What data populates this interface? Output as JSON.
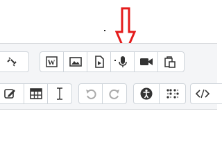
{
  "toolbar_row_1": {
    "buttons": [
      {
        "icon": "unlink-icon"
      },
      {
        "icon": "word-paste-icon",
        "text": "W"
      },
      {
        "icon": "image-icon"
      },
      {
        "icon": "media-file-icon"
      },
      {
        "icon": "microphone-icon"
      },
      {
        "icon": "video-camera-icon"
      },
      {
        "icon": "copy-paste-icon"
      }
    ]
  },
  "toolbar_row_2": {
    "buttons": [
      {
        "icon": "edit-icon"
      },
      {
        "icon": "table-icon"
      },
      {
        "icon": "text-cursor-icon"
      },
      {
        "icon": "undo-icon"
      },
      {
        "icon": "redo-icon"
      },
      {
        "icon": "accessibility-icon"
      },
      {
        "icon": "braille-icon"
      },
      {
        "icon": "code-icon"
      }
    ]
  },
  "annotation": {
    "color": "#e41b1b"
  }
}
